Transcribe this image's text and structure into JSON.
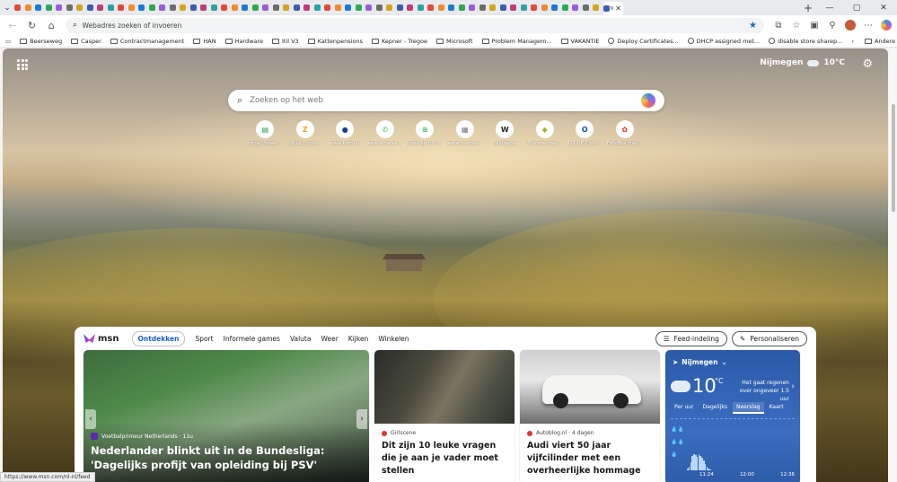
{
  "browser": {
    "tab_count_visible": 58,
    "active_tab_label": "N",
    "address_placeholder": "Webadres zoeken of invoeren",
    "bookmarks": [
      {
        "label": "Beerseweg",
        "icon": "folder-icon"
      },
      {
        "label": "Casper",
        "icon": "folder-icon"
      },
      {
        "label": "Contractmanagement",
        "icon": "folder-icon"
      },
      {
        "label": "HAN",
        "icon": "folder-icon"
      },
      {
        "label": "Hardware",
        "icon": "folder-icon"
      },
      {
        "label": "Itil V3",
        "icon": "folder-icon"
      },
      {
        "label": "Kattenpensions",
        "icon": "folder-icon"
      },
      {
        "label": "Kepner - Tregoe",
        "icon": "folder-icon"
      },
      {
        "label": "Microsoft",
        "icon": "folder-icon"
      },
      {
        "label": "Problem Managem...",
        "icon": "folder-icon"
      },
      {
        "label": "VAKANTIE",
        "icon": "folder-icon"
      },
      {
        "label": "Deploy Certificates...",
        "icon": "globe-icon"
      },
      {
        "label": "DHCP assigned met...",
        "icon": "globe-icon"
      },
      {
        "label": "disable store sharep...",
        "icon": "globe-icon"
      }
    ],
    "other_favorites": "Andere favorieten",
    "status_url": "https://www.msn.com/nl-nl/feed"
  },
  "newtab": {
    "weather": {
      "city": "Nijmegen",
      "temp": "10",
      "unit": "°C"
    },
    "search_placeholder": "Zoeken op het web",
    "quicklinks": [
      {
        "label": "https://www....",
        "glyph": "▤",
        "color": "#1aa84a"
      },
      {
        "label": "https://com...",
        "glyph": "Z",
        "color": "#f0a020"
      },
      {
        "label": "www.knmi.nl",
        "glyph": "●",
        "color": "#1c3f8f"
      },
      {
        "label": "web.whatsa...",
        "glyph": "✆",
        "color": "#25d366"
      },
      {
        "label": "open.spotify....",
        "glyph": "≋",
        "color": "#1db954"
      },
      {
        "label": "www.minder...",
        "glyph": "▦",
        "color": "#777777"
      },
      {
        "label": "Wikipedia",
        "glyph": "W",
        "color": "#222222"
      },
      {
        "label": "Slimme met...",
        "glyph": "◆",
        "color": "#a5b52a"
      },
      {
        "label": "O2 DE Com...",
        "glyph": "O",
        "color": "#0a4fc7"
      },
      {
        "label": "FritzBox Han...",
        "glyph": "✿",
        "color": "#e0302b"
      }
    ],
    "feed": {
      "logo": "msn",
      "tabs": [
        "Ontdekken",
        "Sport",
        "Informele games",
        "Valuta",
        "Weer",
        "Kijken",
        "Winkelen"
      ],
      "active_tab": "Ontdekken",
      "feed_layout_label": "Feed-indeling",
      "personalize_label": "Personaliseren",
      "hero": {
        "source": "Voetbalprimeur Netherlands · 11u",
        "title": "Nederlander blinkt uit in de Bundesliga: 'Dagelijks profijt van opleiding bij PSV'"
      },
      "card1": {
        "source": "Girlscene",
        "title": "Dit zijn 10 leuke vragen die je aan je vader moet stellen"
      },
      "card2": {
        "source": "Autoblog.nl · 4 dagen",
        "title": "Audi viert 50 jaar vijfcilinder met een overheerlijke hommage"
      },
      "weather_card": {
        "city": "Nijmegen",
        "temp": "10",
        "unit": "°C",
        "desc": "Het gaat regenen over ongeveer 1.5 uur",
        "tabs": [
          "Per uur",
          "Dagelijks",
          "Neerslag",
          "Kaart"
        ],
        "active_tab": "Neerslag",
        "times": [
          "11:24",
          "12:00",
          "12:36"
        ],
        "precip": [
          0.1,
          0.2,
          0.5,
          0.9,
          1.0,
          0.95,
          0.85,
          1.0,
          0.9,
          0.8,
          0.6,
          0.4,
          0.25,
          0.1,
          0.05
        ]
      }
    }
  }
}
